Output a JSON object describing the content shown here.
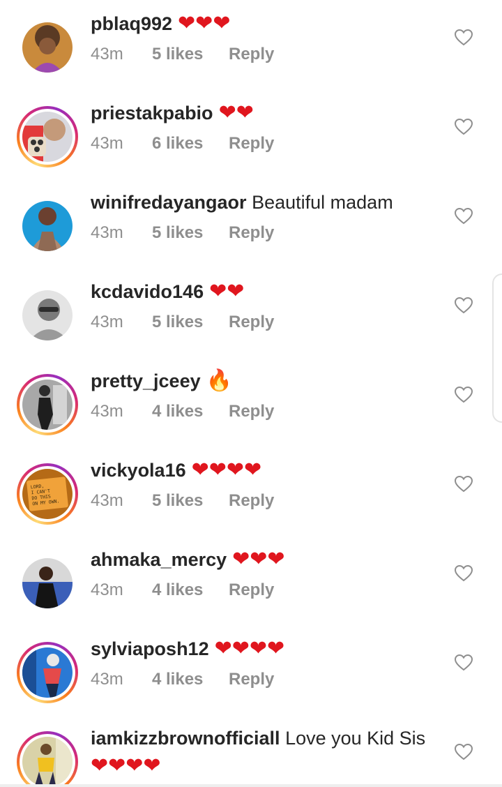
{
  "comments": [
    {
      "username": "pblaq992",
      "text": "",
      "emoji": "❤❤❤",
      "time": "43m",
      "likes": "5 likes",
      "reply": "Reply",
      "story_ring": false,
      "avatar_colors": [
        "#c98a3c",
        "#5a3a24"
      ]
    },
    {
      "username": "priestakpabio",
      "text": "",
      "emoji": "❤❤",
      "time": "43m",
      "likes": "6 likes",
      "reply": "Reply",
      "story_ring": true,
      "avatar_colors": [
        "#c9c9d2",
        "#e23a3a"
      ]
    },
    {
      "username": "winifredayangaor",
      "text": "Beautiful madam",
      "emoji": "",
      "time": "43m",
      "likes": "5 likes",
      "reply": "Reply",
      "story_ring": false,
      "avatar_colors": [
        "#1e9bd8",
        "#7a5a48"
      ]
    },
    {
      "username": "kcdavido146",
      "text": "",
      "emoji": "❤❤",
      "time": "43m",
      "likes": "5 likes",
      "reply": "Reply",
      "story_ring": false,
      "avatar_colors": [
        "#dadada",
        "#6a6a6a"
      ]
    },
    {
      "username": "pretty_jceey",
      "text": "",
      "emoji": "🔥",
      "time": "43m",
      "likes": "4 likes",
      "reply": "Reply",
      "story_ring": true,
      "avatar_colors": [
        "#8c8c8c",
        "#2b2b2b"
      ]
    },
    {
      "username": "vickyola16",
      "text": "",
      "emoji": "❤❤❤❤",
      "time": "43m",
      "likes": "5 likes",
      "reply": "Reply",
      "story_ring": true,
      "avatar_colors": [
        "#f0a23a",
        "#b56a16"
      ]
    },
    {
      "username": "ahmaka_mercy",
      "text": "",
      "emoji": "❤❤❤",
      "time": "43m",
      "likes": "4 likes",
      "reply": "Reply",
      "story_ring": false,
      "avatar_colors": [
        "#3b5fb8",
        "#1c1c1c"
      ]
    },
    {
      "username": "sylviaposh12",
      "text": "",
      "emoji": "❤❤❤❤",
      "time": "43m",
      "likes": "4 likes",
      "reply": "Reply",
      "story_ring": true,
      "avatar_colors": [
        "#2a79d4",
        "#e54a4a"
      ]
    },
    {
      "username": "iamkizzbrownofficiall",
      "text": "Love you Kid Sis",
      "emoji": "",
      "second_line": "❤❤❤❤",
      "story_ring": true,
      "avatar_colors": [
        "#d9d2a8",
        "#f0c020"
      ]
    }
  ],
  "avatar_sign_text": [
    "LORD,",
    "I CAN'T",
    "DO THIS",
    "ON MY OWN."
  ],
  "icons": {
    "like": "heart-outline-icon"
  },
  "colors": {
    "username": "#262626",
    "meta": "#8e8e8e",
    "heart": "#e0161e"
  }
}
